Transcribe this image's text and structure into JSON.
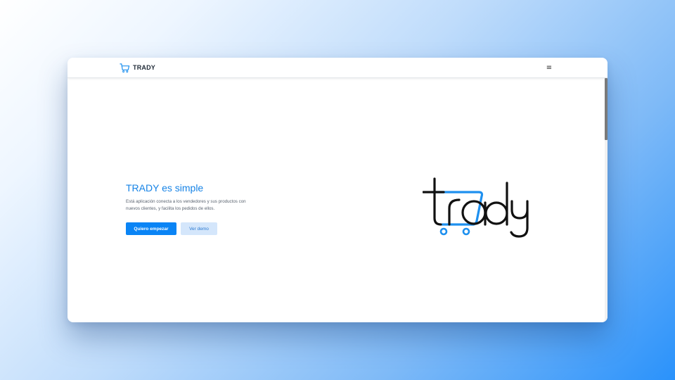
{
  "navbar": {
    "brand_name": "TRADY",
    "brand_icon": "cart-icon",
    "menu_icon": "hamburger-menu-icon",
    "menu_glyph": "≡"
  },
  "hero": {
    "title": "TRADY es simple",
    "description": "Está aplicación conecta a los vendedores y sus productos con nuevos clientes, y facilita los pedidos de ellos.",
    "primary_button": "Quiero empezar",
    "secondary_button": "Ver demo"
  },
  "logo": {
    "wordmark": "trady",
    "icon": "trady-cart-logo"
  },
  "colors": {
    "accent": "#1683e6",
    "primary_button": "#0a84f5",
    "secondary_button_bg": "#d4e6fb",
    "logo_dark": "#111111",
    "logo_blue": "#1e90ef"
  }
}
